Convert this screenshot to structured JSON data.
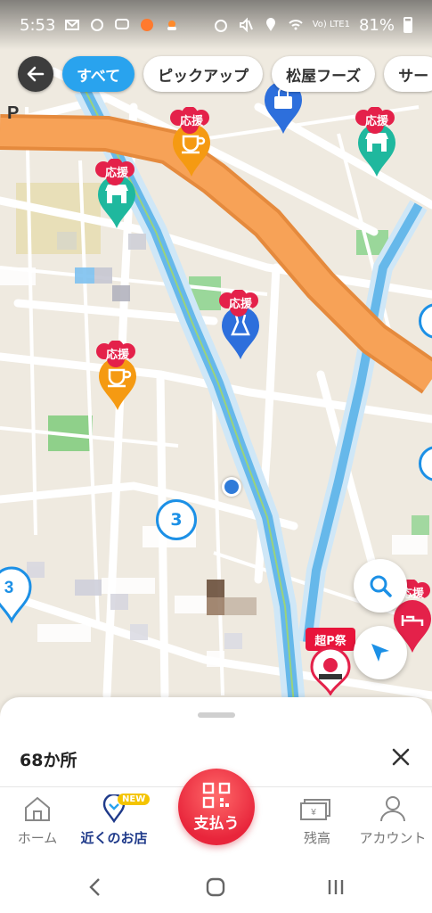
{
  "status_bar": {
    "time": "5:53",
    "battery": "81%",
    "network": "Vo) LTE1"
  },
  "filters": {
    "chips": [
      {
        "label": "すべて",
        "active": true
      },
      {
        "label": "ピックアップ",
        "active": false
      },
      {
        "label": "松屋フーズ",
        "active": false
      },
      {
        "label": "サー",
        "active": false
      }
    ]
  },
  "map": {
    "ouen_label": "応援",
    "cluster_labels": [
      "3",
      "3"
    ],
    "promo_label": "超P祭",
    "parking_label": "P",
    "colors": {
      "teal": "#1fb89e",
      "orange": "#f59a12",
      "blue": "#2d6fdc",
      "pink": "#e4214a",
      "water": "#66b8ea",
      "expressway": "#f7a257"
    }
  },
  "sheet": {
    "count": "68か所"
  },
  "tabs": {
    "home": "ホーム",
    "nearby": "近くのお店",
    "new_badge": "NEW",
    "pay": "支払う",
    "balance": "残高",
    "account": "アカウント"
  }
}
